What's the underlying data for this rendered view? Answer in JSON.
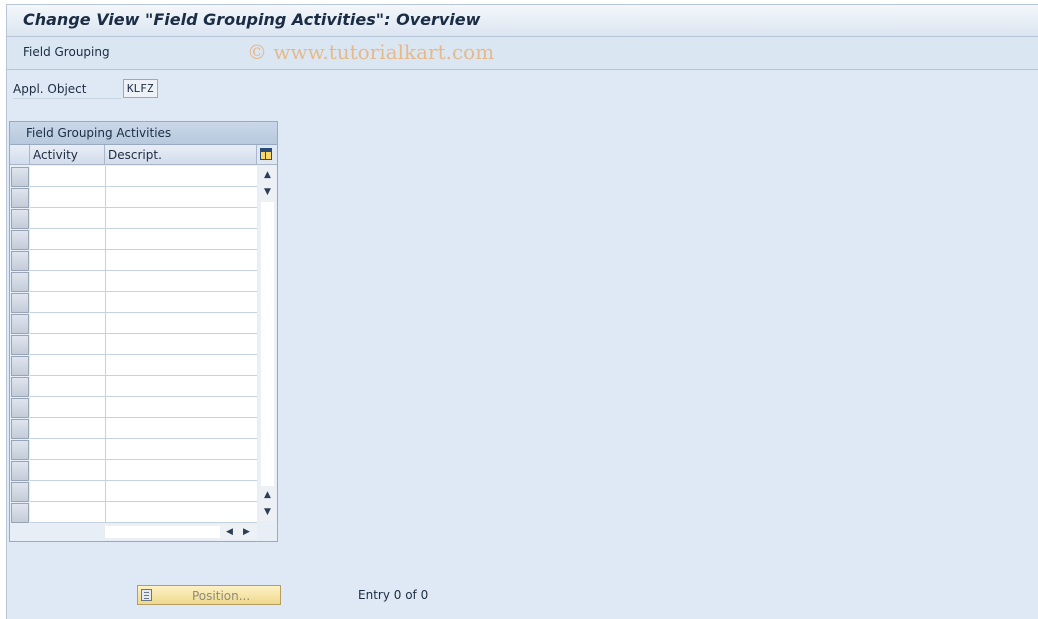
{
  "window": {
    "title": "Change View \"Field Grouping Activities\": Overview"
  },
  "toolbar": {
    "field_grouping_label": "Field Grouping",
    "watermark": "© www.tutorialkart.com"
  },
  "form": {
    "appl_object_label": "Appl. Object",
    "appl_object_value": "KLFZ"
  },
  "table": {
    "title": "Field Grouping Activities",
    "columns": [
      "Activity",
      "Descript."
    ],
    "config_icon": "table-settings-icon",
    "rows": []
  },
  "scrollbar_icons": {
    "up": "▲",
    "down": "▼",
    "left": "◀",
    "right": "▶"
  },
  "footer": {
    "position_button_label": "Position...",
    "position_icon": "position-icon",
    "entry_text": "Entry 0 of 0"
  }
}
